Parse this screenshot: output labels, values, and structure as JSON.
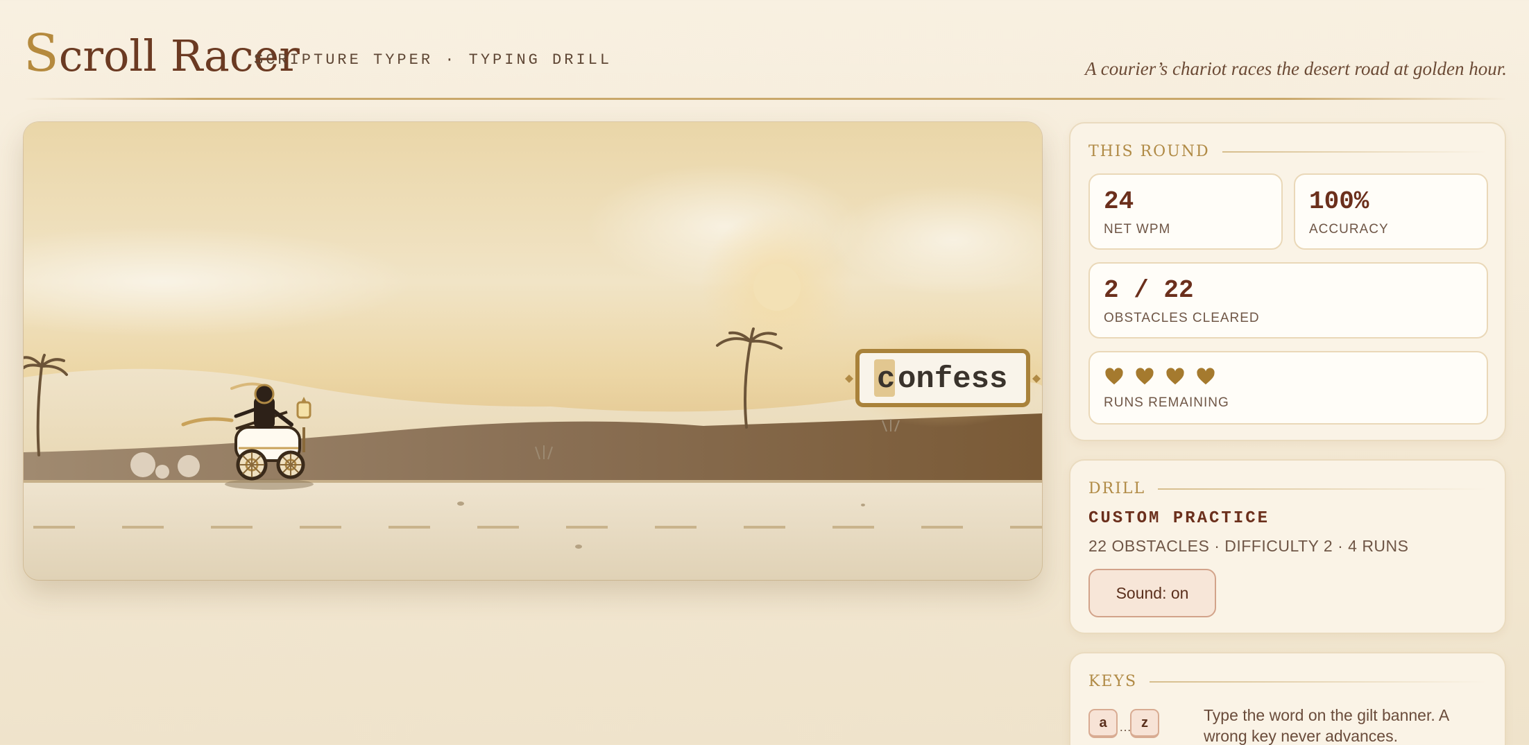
{
  "header": {
    "title_first": "S",
    "title_rest": "croll Racer",
    "subtitle": "SCRIPTURE TYPER · TYPING DRILL",
    "tagline": "A courier’s chariot races the desert road at golden hour."
  },
  "game": {
    "target_word_typed": "c",
    "target_word_rest": "onfess",
    "scene_icons": [
      "sun-icon",
      "palm-tree-icon",
      "chariot-icon",
      "courier-icon",
      "lantern-icon",
      "grass-tuft-icon"
    ]
  },
  "round": {
    "heading": "THIS ROUND",
    "net_wpm": "24",
    "net_wpm_label": "NET WPM",
    "accuracy": "100%",
    "accuracy_label": "ACCURACY",
    "obstacles": "2 / 22",
    "obstacles_label": "OBSTACLES CLEARED",
    "runs_remaining": 4,
    "runs_label": "RUNS REMAINING"
  },
  "drill": {
    "heading": "DRILL",
    "name": "CUSTOM PRACTICE",
    "meta": "22 OBSTACLES · DIFFICULTY 2 · 4 RUNS",
    "sound_button": "Sound: on"
  },
  "keys": {
    "heading": "KEYS",
    "key_from": "a",
    "ellipsis": "…",
    "key_to": "z",
    "description": "Type the word on the gilt banner. A wrong key never advances."
  },
  "colors": {
    "accent_gold": "#b08a45",
    "ink_brown": "#6b2f1c",
    "heart": "#a57a2e"
  }
}
